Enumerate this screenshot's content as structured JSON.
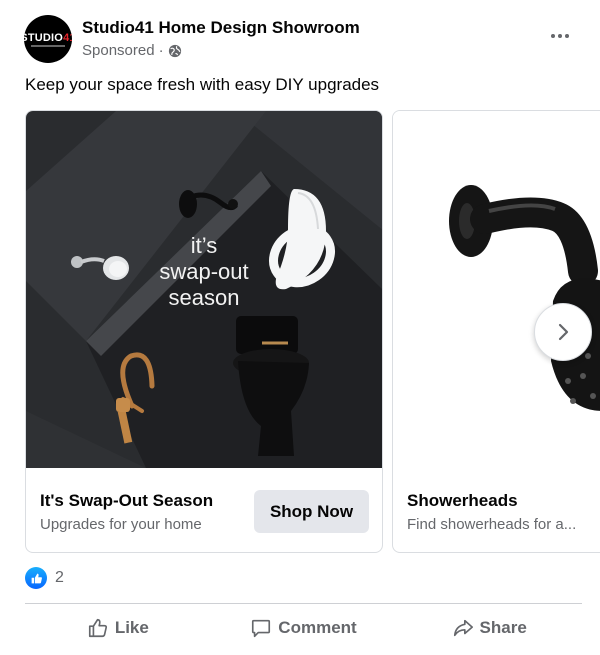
{
  "post": {
    "page_name": "Studio41 Home Design Showroom",
    "sponsored_label": "Sponsored",
    "separator": "·",
    "caption": "Keep your space fresh with easy DIY upgrades",
    "avatar": {
      "logo_text_main": "STUDIO",
      "logo_text_accent": "41",
      "brand_accent": "#e4252b"
    }
  },
  "carousel": {
    "cards": [
      {
        "image_text_line1": "it’s",
        "image_text_line2": "swap-out",
        "image_text_line3": "season",
        "title": "It's Swap-Out Season",
        "subtitle": "Upgrades for your home",
        "button_label": "Shop Now"
      },
      {
        "title": "Showerheads",
        "subtitle": "Find showerheads for a..."
      }
    ]
  },
  "reactions": {
    "count": "2",
    "icon": "like-reaction-icon"
  },
  "actions": {
    "like": "Like",
    "comment": "Comment",
    "share": "Share"
  },
  "colors": {
    "accent": "#0866ff",
    "muted_text": "#65676b",
    "button_bg": "#e4e6eb"
  }
}
